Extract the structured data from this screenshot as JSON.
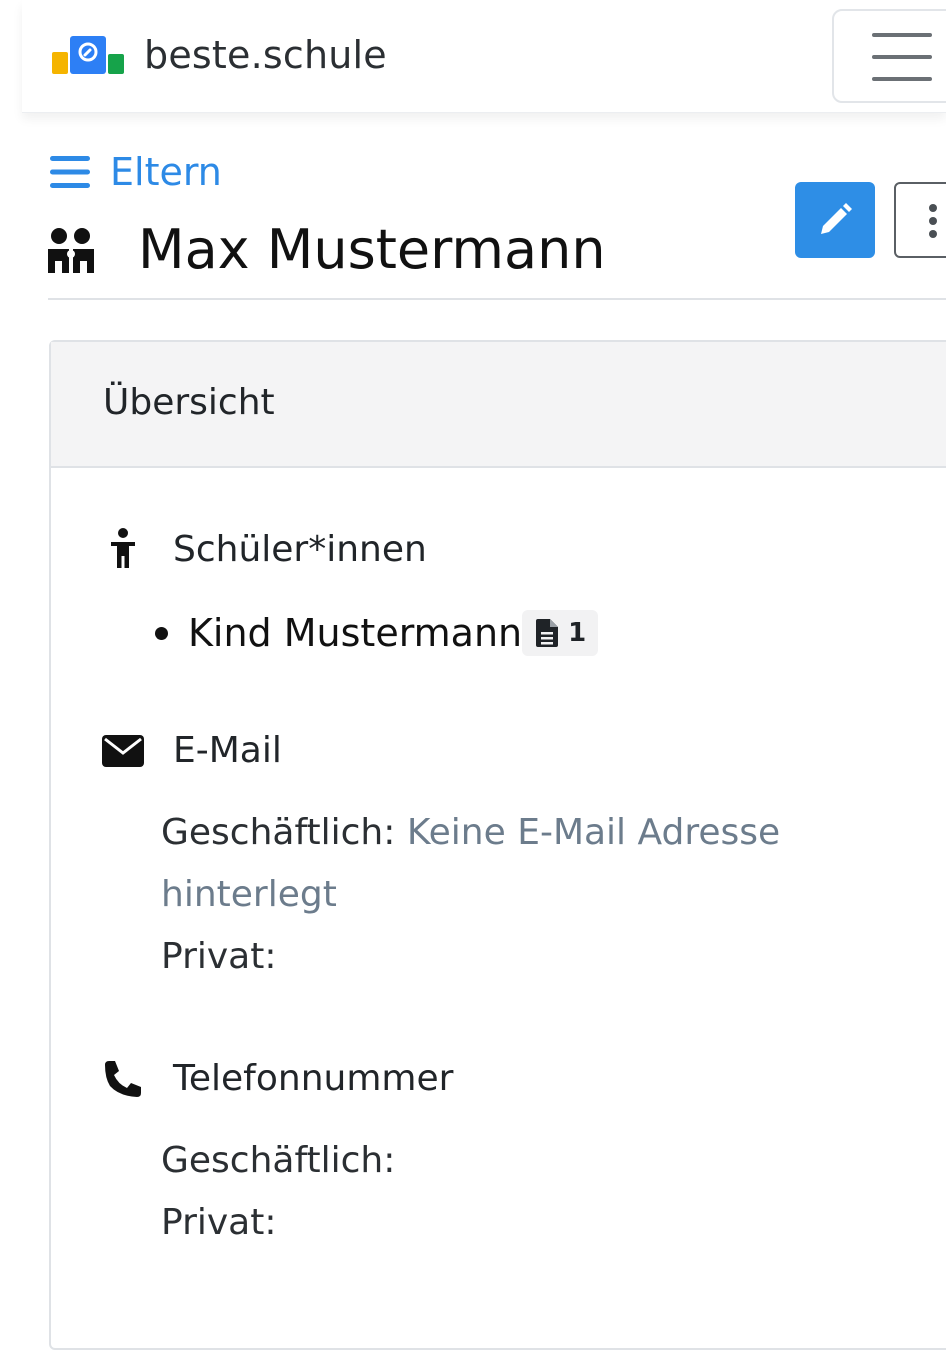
{
  "navbar": {
    "brand_name": "beste.schule"
  },
  "header": {
    "breadcrumb_label": "Eltern",
    "title": "Max Mustermann"
  },
  "card": {
    "header_label": "Übersicht",
    "students": {
      "label": "Schüler*innen",
      "items": [
        {
          "name": "Kind Mustermann",
          "doc_count": "1"
        }
      ]
    },
    "email": {
      "label": "E-Mail",
      "business_label": "Geschäftlich:",
      "business_value_line1": "Keine E-Mail Adresse",
      "business_value_line2": "hinterlegt",
      "private_label": "Privat:"
    },
    "phone": {
      "label": "Telefonnummer",
      "business_label": "Geschäftlich:",
      "private_label": "Privat:"
    }
  },
  "colors": {
    "primary": "#2e8ee6",
    "link": "#2d8ae6",
    "muted_text": "#6c7c8c"
  },
  "icons": {
    "logo": "beste-schule-logo",
    "menu": "hamburger-menu-icon",
    "breadcrumb": "list-icon",
    "title": "people-icon",
    "edit": "pencil-icon",
    "more": "vertical-dots-icon",
    "students": "child-icon",
    "doc": "file-icon",
    "email": "envelope-icon",
    "phone": "phone-icon"
  }
}
